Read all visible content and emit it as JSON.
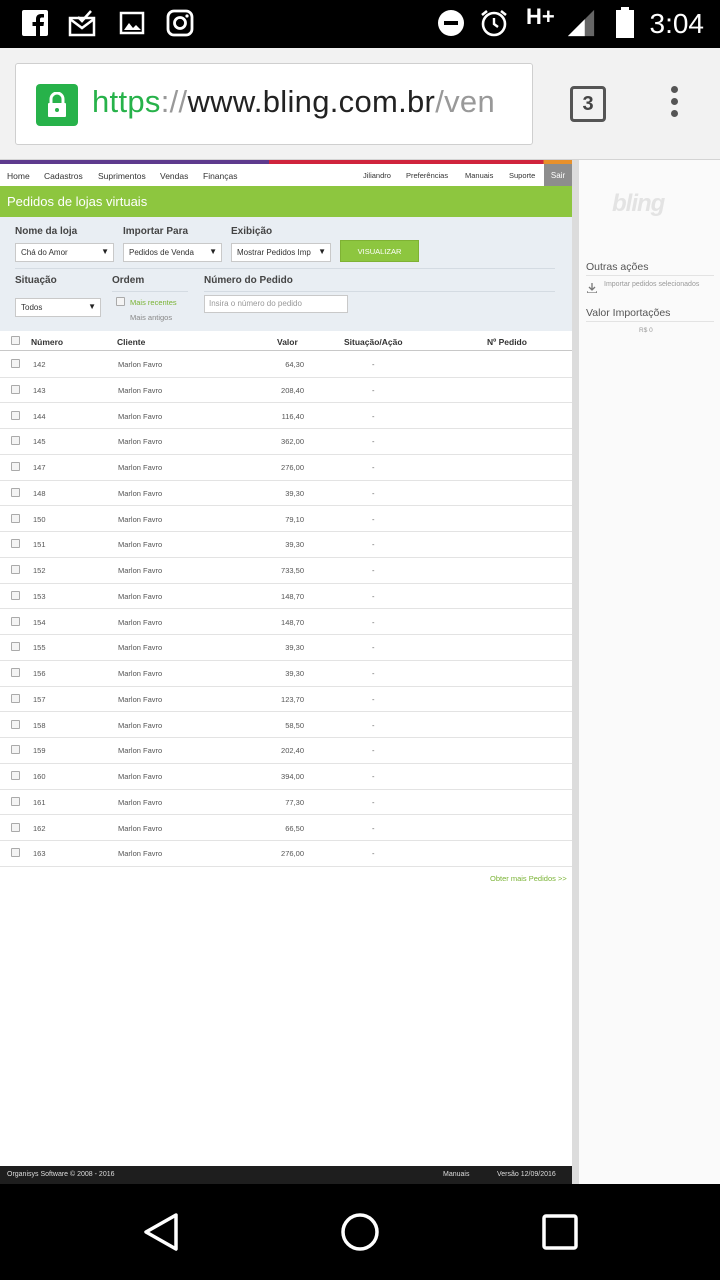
{
  "status_bar": {
    "time": "3:04",
    "network": "H+",
    "icons": [
      "facebook-icon",
      "mail-icon",
      "image-icon",
      "instagram-icon",
      "dnd-icon",
      "alarm-icon",
      "signal-icon",
      "battery-icon"
    ]
  },
  "browser": {
    "url_protocol": "https",
    "url_sep": "://",
    "url_host": "www.bling.com.br",
    "url_path": "/ven",
    "tab_count": "3"
  },
  "nav": {
    "items": [
      "Home",
      "Cadastros",
      "Suprimentos",
      "Vendas",
      "Finanças"
    ],
    "right_items": [
      "Jiliandro",
      "Preferências",
      "Manuais",
      "Suporte"
    ],
    "logout": "Sair"
  },
  "page_title": "Pedidos de lojas virtuais",
  "filters": {
    "store_label": "Nome da loja",
    "store_value": "Chá do Amor",
    "import_label": "Importar Para",
    "import_value": "Pedidos de Venda",
    "display_label": "Exibição",
    "display_value": "Mostrar Pedidos Imp",
    "view_button": "VISUALIZAR",
    "status_label": "Situação",
    "status_value": "Todos",
    "order_label": "Ordem",
    "order_recent": "Mais recentes",
    "order_old": "Mais antigos",
    "number_label": "Número do Pedido",
    "number_placeholder": "Insira o número do pedido"
  },
  "table": {
    "headers": [
      "Número",
      "Cliente",
      "Valor",
      "Situação/Ação",
      "Nº Pedido"
    ],
    "rows": [
      {
        "numero": "142",
        "cliente": "Marlon Favro",
        "valor": "64,30",
        "situacao": "-"
      },
      {
        "numero": "143",
        "cliente": "Marlon Favro",
        "valor": "208,40",
        "situacao": "-"
      },
      {
        "numero": "144",
        "cliente": "Marlon Favro",
        "valor": "116,40",
        "situacao": "-"
      },
      {
        "numero": "145",
        "cliente": "Marlon Favro",
        "valor": "362,00",
        "situacao": "-"
      },
      {
        "numero": "147",
        "cliente": "Marlon Favro",
        "valor": "276,00",
        "situacao": "-"
      },
      {
        "numero": "148",
        "cliente": "Marlon Favro",
        "valor": "39,30",
        "situacao": "-"
      },
      {
        "numero": "150",
        "cliente": "Marlon Favro",
        "valor": "79,10",
        "situacao": "-"
      },
      {
        "numero": "151",
        "cliente": "Marlon Favro",
        "valor": "39,30",
        "situacao": "-"
      },
      {
        "numero": "152",
        "cliente": "Marlon Favro",
        "valor": "733,50",
        "situacao": "-"
      },
      {
        "numero": "153",
        "cliente": "Marlon Favro",
        "valor": "148,70",
        "situacao": "-"
      },
      {
        "numero": "154",
        "cliente": "Marlon Favro",
        "valor": "148,70",
        "situacao": "-"
      },
      {
        "numero": "155",
        "cliente": "Marlon Favro",
        "valor": "39,30",
        "situacao": "-"
      },
      {
        "numero": "156",
        "cliente": "Marlon Favro",
        "valor": "39,30",
        "situacao": "-"
      },
      {
        "numero": "157",
        "cliente": "Marlon Favro",
        "valor": "123,70",
        "situacao": "-"
      },
      {
        "numero": "158",
        "cliente": "Marlon Favro",
        "valor": "58,50",
        "situacao": "-"
      },
      {
        "numero": "159",
        "cliente": "Marlon Favro",
        "valor": "202,40",
        "situacao": "-"
      },
      {
        "numero": "160",
        "cliente": "Marlon Favro",
        "valor": "394,00",
        "situacao": "-"
      },
      {
        "numero": "161",
        "cliente": "Marlon Favro",
        "valor": "77,30",
        "situacao": "-"
      },
      {
        "numero": "162",
        "cliente": "Marlon Favro",
        "valor": "66,50",
        "situacao": "-"
      },
      {
        "numero": "163",
        "cliente": "Marlon Favro",
        "valor": "276,00",
        "situacao": "-"
      }
    ],
    "more_link": "Obter mais Pedidos >>"
  },
  "sidebar": {
    "logo": "bling",
    "other_actions_title": "Outras ações",
    "import_selected": "Importar pedidos selecionados",
    "import_value_title": "Valor Importações",
    "import_value": "R$ 0"
  },
  "footer": {
    "copyright": "Organisys Software © 2008 - 2016",
    "manuals": "Manuais",
    "version": "Versão 12/09/2016"
  },
  "colors": {
    "accent_green": "#8dc63f",
    "lock_green": "#27b24a",
    "filter_bg": "#e9eef3"
  }
}
